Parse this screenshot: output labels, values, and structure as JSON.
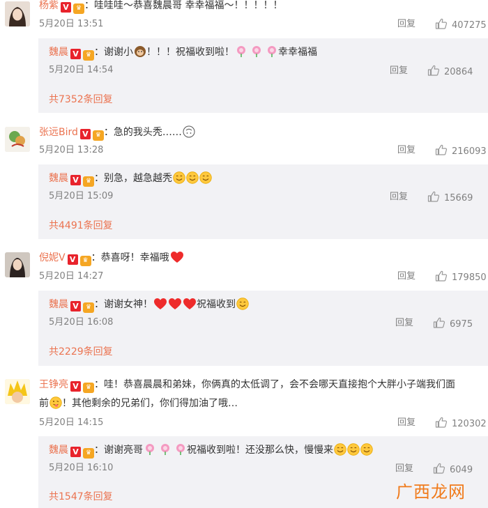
{
  "comments": [
    {
      "user": "杨紫",
      "colon": "：",
      "text": "哇哇哇～恭喜魏晨哥 幸幸福福～！！！！！",
      "time": "5月20日 13:51",
      "reply_label": "回复",
      "likes": "407275",
      "reply": {
        "user": "魏晨",
        "colon": "：",
        "text_a": "谢谢小",
        "text_b": "！！！祝福收到啦！",
        "text_c": "幸幸福福",
        "time": "5月20日 14:54",
        "reply_label": "回复",
        "likes": "20864"
      },
      "more": "共7352条回复"
    },
    {
      "user": "张远Bird",
      "colon": "：",
      "text": "急的我头秃……",
      "time": "5月20日 13:28",
      "reply_label": "回复",
      "likes": "216093",
      "reply": {
        "user": "魏晨",
        "colon": "：",
        "text_a": "别急，越急越秃",
        "time": "5月20日 15:09",
        "reply_label": "回复",
        "likes": "15669"
      },
      "more": "共4491条回复"
    },
    {
      "user": "倪妮V",
      "colon": "：",
      "text": "恭喜呀！幸福哦",
      "time": "5月20日 14:27",
      "reply_label": "回复",
      "likes": "179850",
      "reply": {
        "user": "魏晨",
        "colon": "：",
        "text_a": "谢谢女神！",
        "text_b": "祝福收到",
        "time": "5月20日 16:08",
        "reply_label": "回复",
        "likes": "6975"
      },
      "more": "共2229条回复"
    },
    {
      "user": "王铮亮",
      "colon": "：",
      "text_l1": "哇！恭喜晨晨和弟妹，你俩真的太低调了，会不会哪天直接抱个大胖小子端我们面",
      "text_l2a": "前",
      "text_l2b": "！其他剩余的兄弟们，你们得加油了哦…",
      "time": "5月20日 14:15",
      "reply_label": "回复",
      "likes": "120302",
      "reply": {
        "user": "魏晨",
        "colon": "：",
        "text_a": "谢谢亮哥",
        "text_b": "祝福收到啦！还没那么快，慢慢来",
        "time": "5月20日 16:10",
        "reply_label": "回复",
        "likes": "6049"
      },
      "more": "共1547条回复"
    }
  ],
  "badge_v": "V",
  "watermark": "广西龙网",
  "colors": {
    "username": "#eb7350",
    "meta": "#808080",
    "reply_bg": "#f2f2f5",
    "watermark": "#f07a1a"
  }
}
